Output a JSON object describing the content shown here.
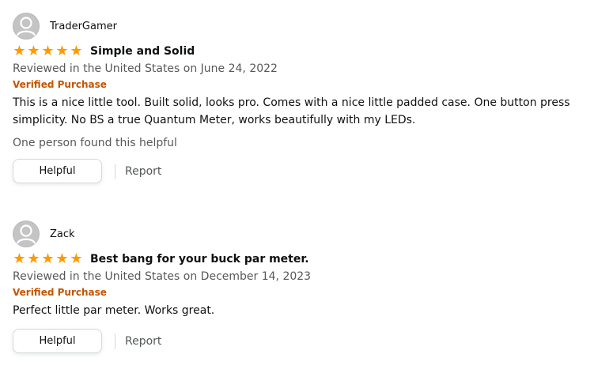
{
  "colors": {
    "star": "#ff9900",
    "verified": "#c45500",
    "muted": "#565959"
  },
  "reviews": [
    {
      "author": "TraderGamer",
      "rating": 5,
      "title": "Simple and Solid",
      "date": "Reviewed in the United States on June 24, 2022",
      "verified": "Verified Purchase",
      "body_line1": "This is a nice little tool. Built solid, looks pro. Comes with a nice little padded case. One button press",
      "body_line2": "simplicity. No BS a true Quantum Meter, works beautifully with my LEDs.",
      "helpful_count": "One person found this helpful",
      "helpful_label": "Helpful",
      "report_label": "Report"
    },
    {
      "author": "Zack",
      "rating": 5,
      "title": "Best bang for your buck par meter.",
      "date": "Reviewed in the United States on December 14, 2023",
      "verified": "Verified Purchase",
      "body_line1": "Perfect little par meter. Works great.",
      "helpful_label": "Helpful",
      "report_label": "Report"
    }
  ]
}
